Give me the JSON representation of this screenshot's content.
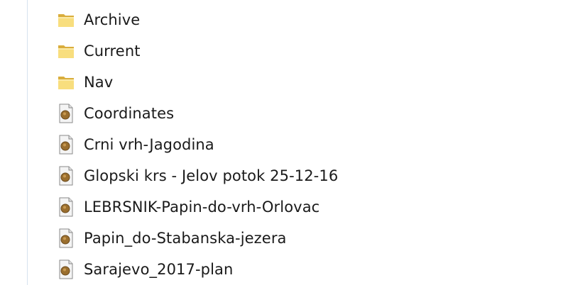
{
  "items": [
    {
      "name": "Archive",
      "type": "folder",
      "icon": "folder-icon"
    },
    {
      "name": "Current",
      "type": "folder",
      "icon": "folder-icon"
    },
    {
      "name": "Nav",
      "type": "folder",
      "icon": "folder-icon"
    },
    {
      "name": "Coordinates",
      "type": "file",
      "icon": "document-icon"
    },
    {
      "name": "Crni vrh-Jagodina",
      "type": "file",
      "icon": "document-icon"
    },
    {
      "name": "Glopski krs - Jelov potok 25-12-16",
      "type": "file",
      "icon": "document-icon"
    },
    {
      "name": "LEBRSNIK-Papin-do-vrh-Orlovac",
      "type": "file",
      "icon": "document-icon"
    },
    {
      "name": "Papin_do-Stabanska-jezera",
      "type": "file",
      "icon": "document-icon"
    },
    {
      "name": "Sarajevo_2017-plan",
      "type": "file",
      "icon": "document-icon"
    }
  ],
  "colors": {
    "folder_light": "#f8de7e",
    "folder_dark": "#d9ad3c",
    "doc_badge": "#9a6e2e"
  }
}
